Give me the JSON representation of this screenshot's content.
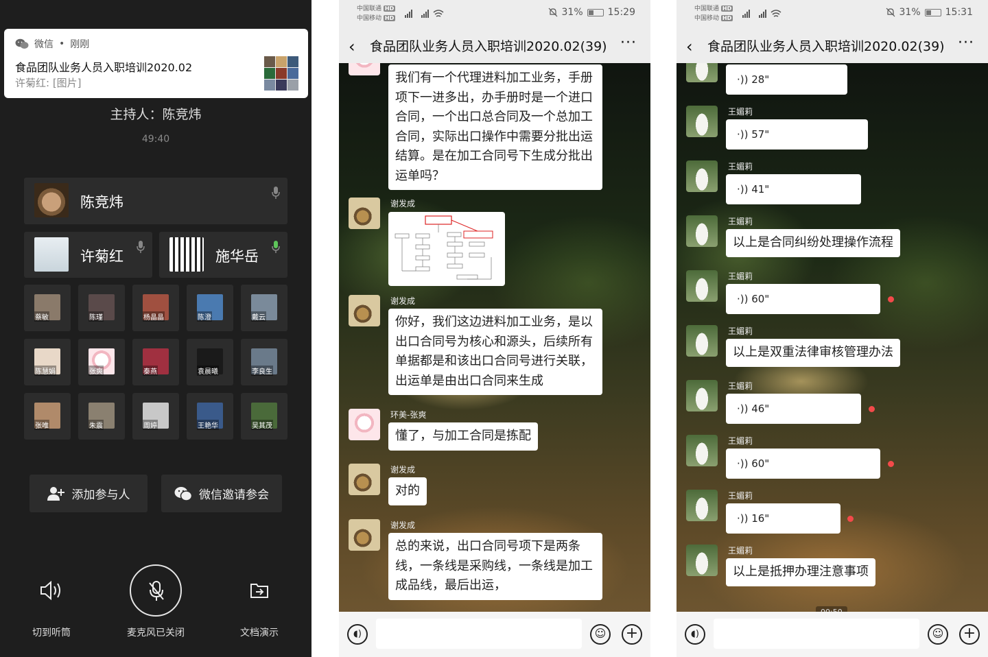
{
  "meeting": {
    "notification": {
      "app": "微信",
      "time": "刚刚",
      "title": "食品团队业务人员入职培训2020.02",
      "content": "许菊红: [图片]"
    },
    "host": "主持人：陈竞炜",
    "elapsed": "49:40",
    "speakers": [
      {
        "name": "陈竞炜"
      },
      {
        "name": "许菊红"
      },
      {
        "name": "施华岳"
      }
    ],
    "participants": [
      "蔡敏",
      "陈瑾",
      "杨晶晶",
      "陈澄",
      "戴云",
      "陈慧娟",
      "张爽",
      "秦燕",
      "袁晨曦",
      "李良生",
      "张唯",
      "朱震",
      "周婷",
      "王艳华",
      "吴其茂"
    ],
    "actions": {
      "add": "添加参与人",
      "invite": "微信邀请参会"
    },
    "controls": {
      "speaker": "切到听筒",
      "mic": "麦克风已关闭",
      "share": "文档演示"
    },
    "colors": {
      "background": "#1e1e1e",
      "card": "#2c2c2c",
      "mic_active": "#5ec45a"
    }
  },
  "chat1": {
    "status": {
      "carrier1": "中国联通",
      "carrier2": "中国移动",
      "battery": "31%",
      "time": "15:29"
    },
    "title": "食品团队业务人员入职培训2020.02(39)",
    "messages": [
      {
        "sender": "",
        "text": "我们有一个代理进料加工业务，手册项下一进多出，办手册时是一个进口合同，一个出口总合同及一个总加工合同，实际出口操作中需要分批出运结算。是在加工合同号下生成分批出运单吗？"
      },
      {
        "sender": "谢发成",
        "image": "flowchart"
      },
      {
        "sender": "谢发成",
        "text": "你好，我们这边进料加工业务，是以出口合同号为核心和源头，后续所有单据都是和该出口合同号进行关联，出运单是由出口合同来生成"
      },
      {
        "sender": "环美-张爽",
        "text": "懂了，与加工合同是拣配"
      },
      {
        "sender": "谢发成",
        "text": "对的"
      },
      {
        "sender": "谢发成",
        "text": "总的来说，出口合同号项下是两条线，一条线是采购线，一条线是加工成品线，最后出运，"
      }
    ]
  },
  "chat2": {
    "status": {
      "carrier1": "中国联通",
      "carrier2": "中国移动",
      "battery": "31%",
      "time": "15:31"
    },
    "title": "食品团队业务人员入职培训2020.02(39)",
    "messages": [
      {
        "sender": "",
        "voice": "28\""
      },
      {
        "sender": "王媚莉",
        "voice": "57\""
      },
      {
        "sender": "王媚莉",
        "voice": "41\""
      },
      {
        "sender": "王媚莉",
        "text": "以上是合同纠纷处理操作流程"
      },
      {
        "sender": "王媚莉",
        "voice": "60\""
      },
      {
        "sender": "王媚莉",
        "text": "以上是双重法律审核管理办法"
      },
      {
        "sender": "王媚莉",
        "voice": "46\""
      },
      {
        "sender": "王媚莉",
        "voice": "60\""
      },
      {
        "sender": "王媚莉",
        "voice": "16\""
      },
      {
        "sender": "王媚莉",
        "text": "以上是抵押办理注意事项"
      }
    ],
    "timestamp_partial": "00:50"
  }
}
